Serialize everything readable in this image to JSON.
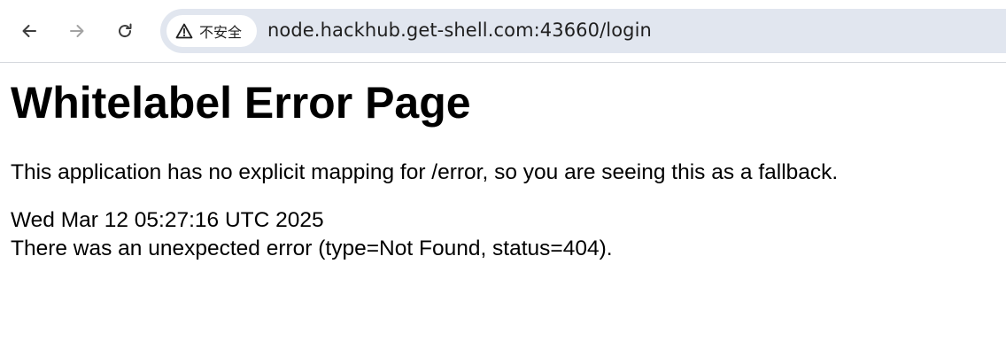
{
  "browser": {
    "security_label": "不安全",
    "url": "node.hackhub.get-shell.com:43660/login",
    "icons": {
      "back": "arrow-left-icon",
      "forward": "arrow-right-icon",
      "reload": "reload-icon",
      "security": "warning-triangle-icon"
    },
    "colors": {
      "omnibox_bg": "#e1e6ef",
      "chip_bg": "#ffffff"
    }
  },
  "page": {
    "title": "Whitelabel Error Page",
    "message": "This application has no explicit mapping for /error, so you are seeing this as a fallback.",
    "timestamp": "Wed Mar 12 05:27:16 UTC 2025",
    "error_detail": "There was an unexpected error (type=Not Found, status=404)."
  }
}
